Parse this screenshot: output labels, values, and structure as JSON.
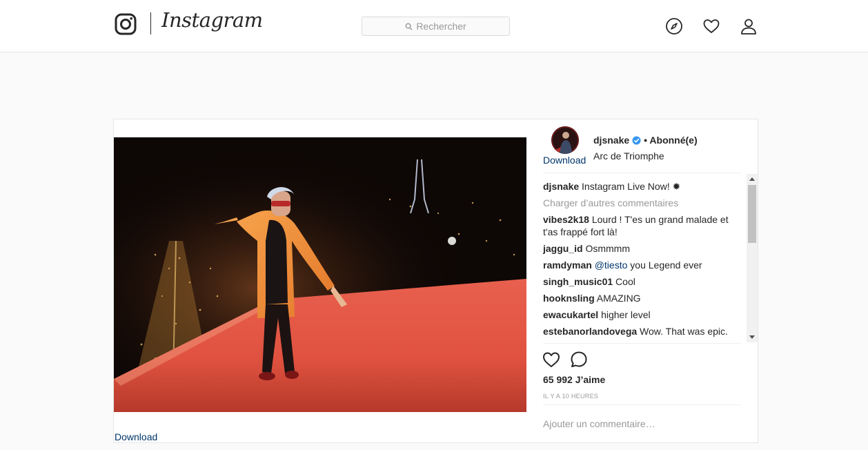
{
  "nav": {
    "wordmark": "Instagram",
    "search_placeholder": "Rechercher"
  },
  "post": {
    "username": "djsnake",
    "follow_status": "• Abonné(e)",
    "location": "Arc de Triomphe",
    "avatar_link": "Download",
    "photo_link": "Download",
    "caption": {
      "user": "djsnake",
      "text": "Instagram Live Now! ✹"
    },
    "load_more": "Charger d’autres commentaires",
    "comments": [
      {
        "user": "vibes2k18",
        "text": "Lourd ! T'es un grand malade et t'as frappé fort là!"
      },
      {
        "user": "jaggu_id",
        "text": "Osmmmm"
      },
      {
        "user": "ramdyman",
        "mention": "@tiesto",
        "text": "you Legend ever"
      },
      {
        "user": "singh_music01",
        "text": "Cool"
      },
      {
        "user": "hooknsling",
        "text": "AMAZING"
      },
      {
        "user": "ewacukartel",
        "text": "higher level"
      },
      {
        "user": "estebanorlandovega",
        "text": "Wow. That was epic."
      }
    ],
    "likes": "65 992 J’aime",
    "time": "IL Y A 10 HEURES",
    "add_comment_placeholder": "Ajouter un commentaire…"
  },
  "colors": {
    "link": "#003569",
    "verified": "#3897f0",
    "muted": "#999999"
  }
}
